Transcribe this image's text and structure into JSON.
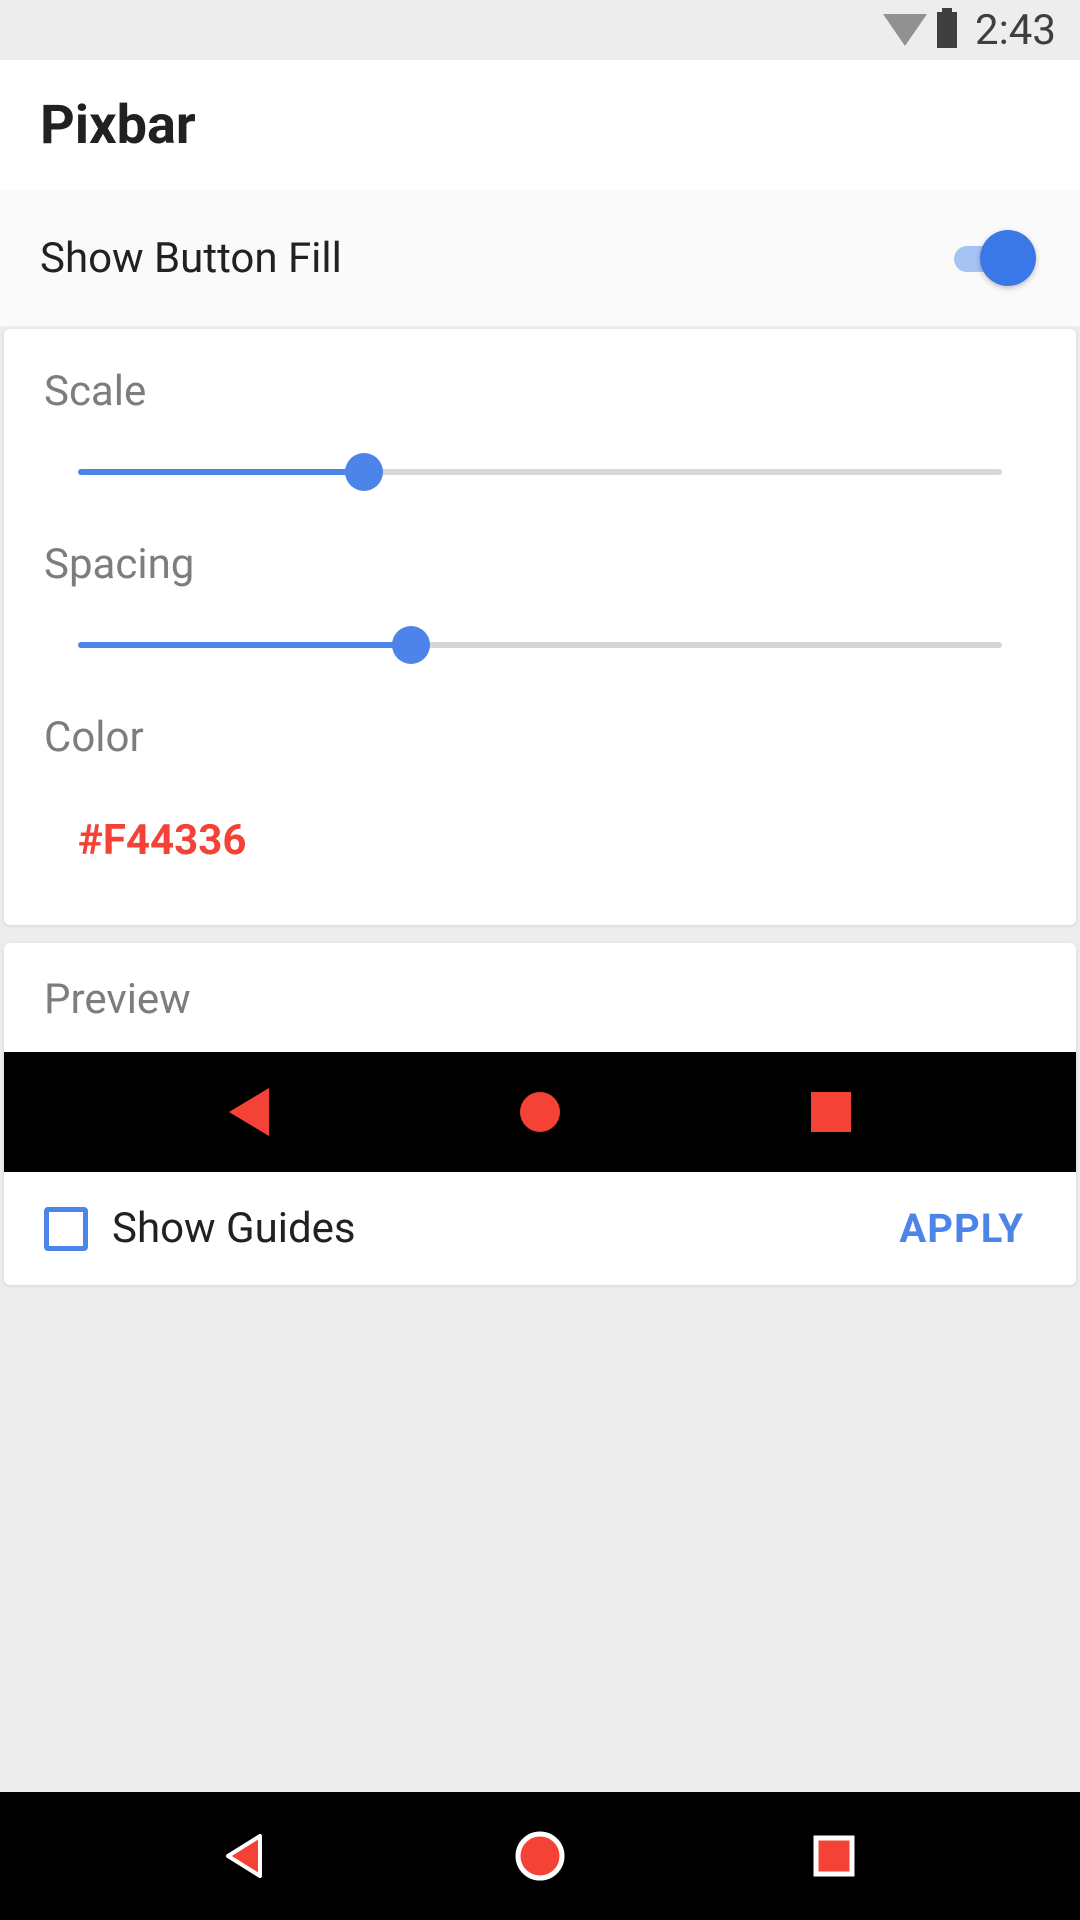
{
  "status_bar": {
    "time": "2:43"
  },
  "app_bar": {
    "title": "Pixbar"
  },
  "toggle": {
    "label": "Show Button Fill",
    "value": true
  },
  "settings": {
    "scale": {
      "label": "Scale",
      "value": 31
    },
    "spacing": {
      "label": "Spacing",
      "value": 36
    },
    "color": {
      "label": "Color",
      "value": "#F44336"
    }
  },
  "preview": {
    "label": "Preview",
    "show_guides_label": "Show Guides",
    "show_guides_checked": false,
    "apply_label": "APPLY",
    "nav_color": "#F44336"
  }
}
